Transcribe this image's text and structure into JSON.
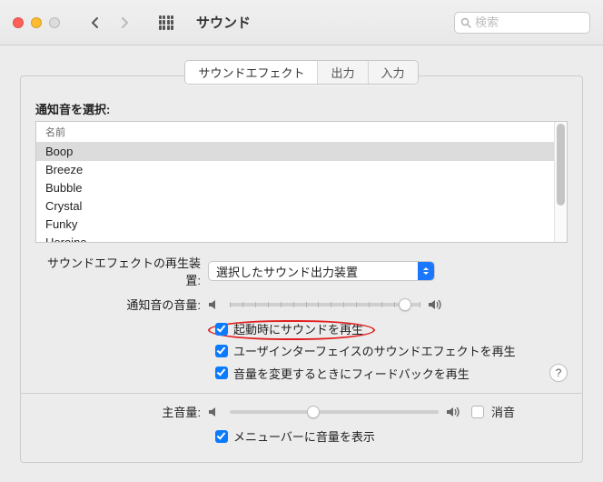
{
  "toolbar": {
    "title": "サウンド",
    "search_placeholder": "検索"
  },
  "tabs": {
    "items": [
      "サウンドエフェクト",
      "出力",
      "入力"
    ],
    "active": 0
  },
  "alert": {
    "section_label": "通知音を選択:",
    "column_header": "名前",
    "sounds": [
      "Boop",
      "Breeze",
      "Bubble",
      "Crystal",
      "Funky",
      "Heroine"
    ],
    "selected_index": 0
  },
  "device": {
    "label": "サウンドエフェクトの再生装置:",
    "value": "選択したサウンド出力装置"
  },
  "alert_volume": {
    "label": "通知音の音量:",
    "percent": 92
  },
  "checks": {
    "startup": "起動時にサウンドを再生",
    "ui_effects": "ユーザインターフェイスのサウンドエフェクトを再生",
    "feedback": "音量を変更するときにフィードバックを再生"
  },
  "output_volume": {
    "label": "主音量:",
    "percent": 40,
    "mute_label": "消音",
    "mute_checked": false
  },
  "menubar": {
    "label": "メニューバーに音量を表示",
    "checked": true
  },
  "help_glyph": "?"
}
